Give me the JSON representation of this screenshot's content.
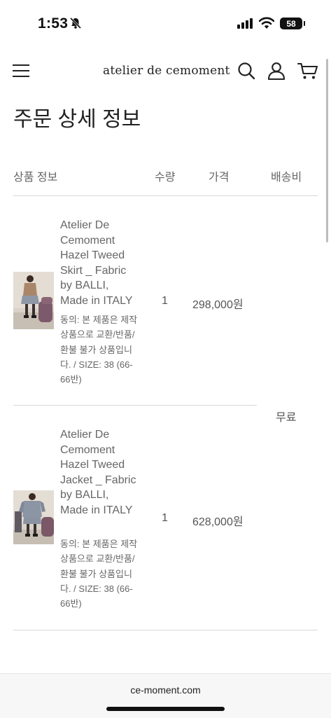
{
  "status_bar": {
    "time": "1:53",
    "battery": "58"
  },
  "header": {
    "logo": "atelier de cemoment"
  },
  "page": {
    "title": "주문 상세 정보"
  },
  "table": {
    "headers": {
      "product": "상품 정보",
      "quantity": "수량",
      "price": "가격",
      "shipping": "배송비"
    },
    "shipping_value": "무료",
    "rows": [
      {
        "name": "Atelier De Cemoment Hazel Tweed Skirt _ Fabric by BALLI, Made in ITALY",
        "option": "동의: 본 제품은 제작 상품으로 교환/반품/환불 불가 상품입니다. / SIZE: 38 (66-66반)",
        "quantity": "1",
        "price": "298,000원"
      },
      {
        "name": "Atelier De Cemoment Hazel Tweed Jacket _ Fabric by BALLI, Made in ITALY",
        "option": "동의: 본 제품은 제작 상품으로 교환/반품/환불 불가 상품입니다. / SIZE: 38 (66-66반)",
        "quantity": "1",
        "price": "628,000원"
      }
    ]
  },
  "browser": {
    "url": "ce-moment.com"
  }
}
